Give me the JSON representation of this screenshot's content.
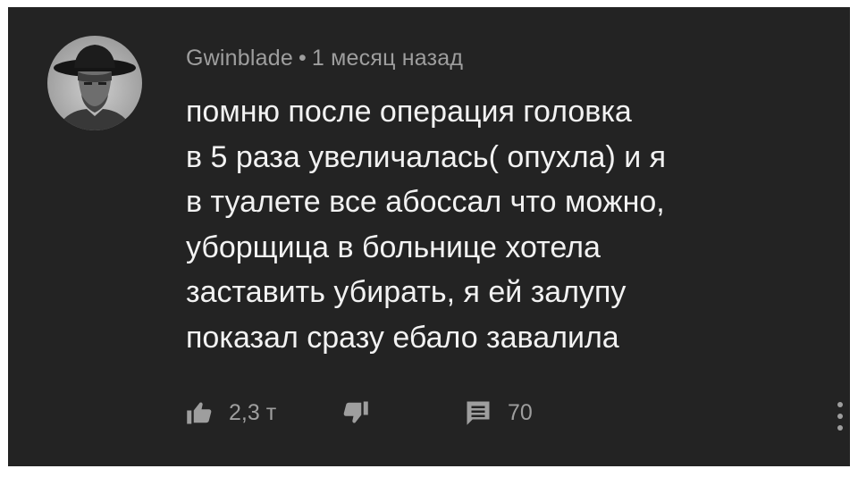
{
  "comment": {
    "author": "Gwinblade",
    "separator": "•",
    "time_ago": "1 месяц назад",
    "text_lines": [
      "помню после операция головка",
      "в 5 раза увеличалась( опухла) и я",
      "в туалете все абоссал что можно,",
      "уборщица в больнице хотела",
      "заставить убирать, я ей залупу",
      "показал сразу ебало завалила"
    ],
    "avatar_icon": "cowboy-portrait-avatar"
  },
  "actions": {
    "like_icon": "thumbs-up-icon",
    "like_count": "2,3 т",
    "dislike_icon": "thumbs-down-icon",
    "reply_icon": "comment-icon",
    "reply_count": "70",
    "more_icon": "more-vertical-icon"
  },
  "colors": {
    "background": "#232323",
    "text": "#f2f2f2",
    "muted": "#9e9e9e"
  }
}
